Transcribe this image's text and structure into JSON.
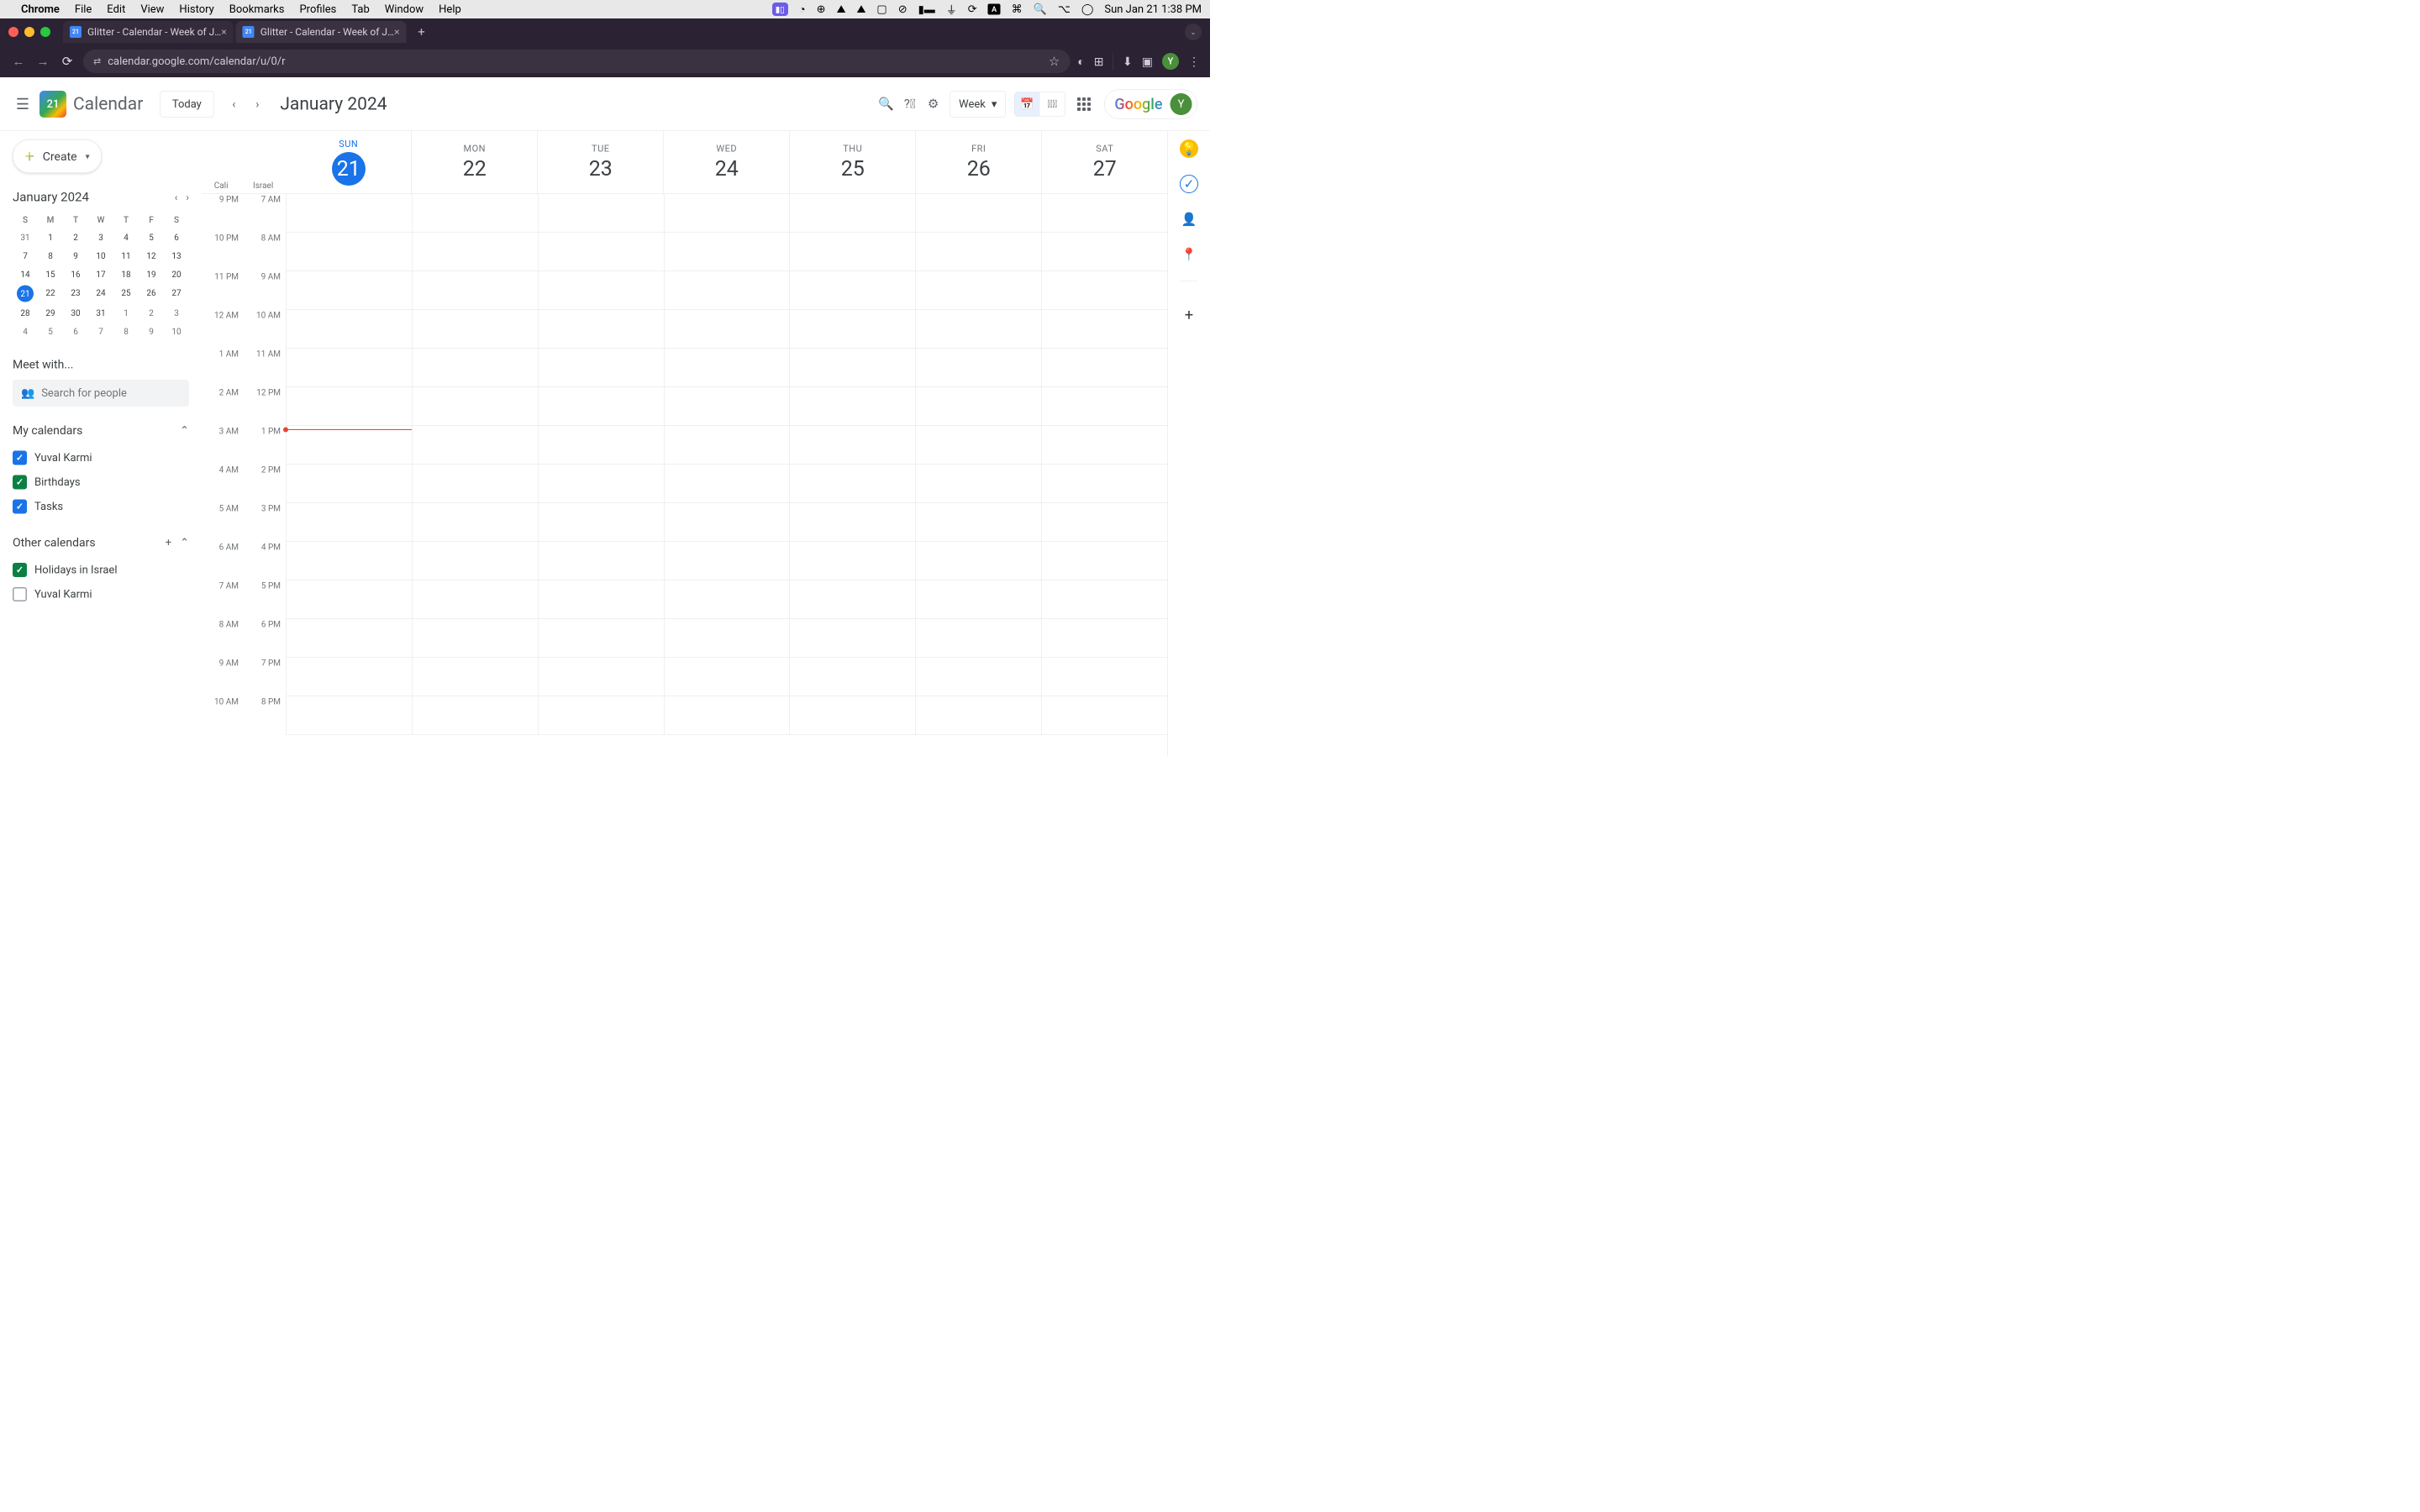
{
  "mac_menu": {
    "app": "Chrome",
    "items": [
      "File",
      "Edit",
      "View",
      "History",
      "Bookmarks",
      "Profiles",
      "Tab",
      "Window",
      "Help"
    ],
    "clock": "Sun Jan 21  1:38 PM"
  },
  "chrome": {
    "tabs": [
      {
        "title": "Glitter - Calendar - Week of J…",
        "active": false
      },
      {
        "title": "Glitter - Calendar - Week of J…",
        "active": true
      }
    ],
    "url": "calendar.google.com/calendar/u/0/r"
  },
  "gcal": {
    "brand": "Calendar",
    "logo_day": "21",
    "today_btn": "Today",
    "month_title": "January 2024",
    "view_label": "Week",
    "avatar_letter": "Y",
    "google_text": "Google"
  },
  "sidebar": {
    "create": "Create",
    "mini_title": "January 2024",
    "dow": [
      "S",
      "M",
      "T",
      "W",
      "T",
      "F",
      "S"
    ],
    "weeks": [
      [
        "31",
        "1",
        "2",
        "3",
        "4",
        "5",
        "6"
      ],
      [
        "7",
        "8",
        "9",
        "10",
        "11",
        "12",
        "13"
      ],
      [
        "14",
        "15",
        "16",
        "17",
        "18",
        "19",
        "20"
      ],
      [
        "21",
        "22",
        "23",
        "24",
        "25",
        "26",
        "27"
      ],
      [
        "28",
        "29",
        "30",
        "31",
        "1",
        "2",
        "3"
      ],
      [
        "4",
        "5",
        "6",
        "7",
        "8",
        "9",
        "10"
      ]
    ],
    "today_day": "21",
    "meet_title": "Meet with...",
    "search_placeholder": "Search for people",
    "my_cal_title": "My calendars",
    "my_cals": [
      {
        "label": "Yuval Karmi",
        "color": "blue",
        "checked": true
      },
      {
        "label": "Birthdays",
        "color": "green",
        "checked": true
      },
      {
        "label": "Tasks",
        "color": "blue",
        "checked": true
      }
    ],
    "other_cal_title": "Other calendars",
    "other_cals": [
      {
        "label": "Holidays in Israel",
        "color": "green",
        "checked": true
      },
      {
        "label": "Yuval Karmi",
        "color": "unchecked",
        "checked": false
      }
    ]
  },
  "week": {
    "tz1": "Cali",
    "tz2": "Israel",
    "days": [
      {
        "dow": "SUN",
        "num": "21",
        "today": true
      },
      {
        "dow": "MON",
        "num": "22"
      },
      {
        "dow": "TUE",
        "num": "23"
      },
      {
        "dow": "WED",
        "num": "24"
      },
      {
        "dow": "THU",
        "num": "25"
      },
      {
        "dow": "FRI",
        "num": "26"
      },
      {
        "dow": "SAT",
        "num": "27"
      }
    ],
    "times_left": [
      "9 PM",
      "10 PM",
      "11 PM",
      "12 AM",
      "1 AM",
      "2 AM",
      "3 AM",
      "4 AM",
      "5 AM",
      "6 AM",
      "7 AM",
      "8 AM",
      "9 AM",
      "10 AM"
    ],
    "times_right": [
      "7 AM",
      "8 AM",
      "9 AM",
      "10 AM",
      "11 AM",
      "12 PM",
      "1 PM",
      "2 PM",
      "3 PM",
      "4 PM",
      "5 PM",
      "6 PM",
      "7 PM",
      "8 PM"
    ]
  }
}
